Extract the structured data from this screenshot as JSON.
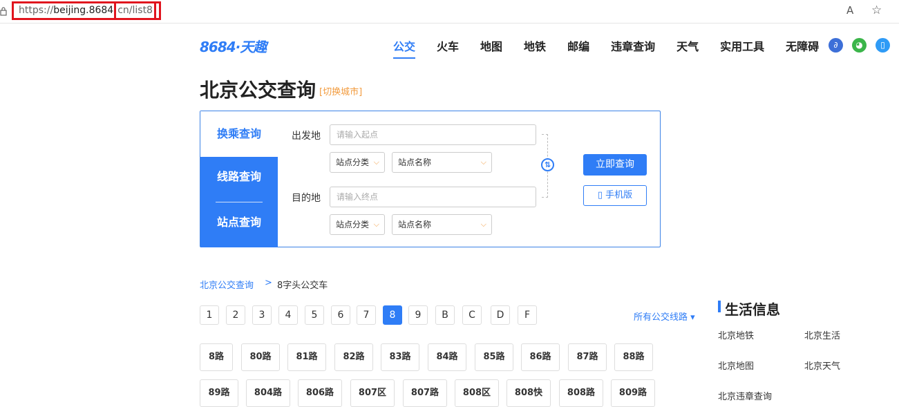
{
  "browser": {
    "url_proto": "https://",
    "url_host": "beijing.8684",
    "url_path": "cn/list8",
    "read_aloud_icon": "A",
    "favorite_icon": "☆"
  },
  "header": {
    "logo": "8684·天趣",
    "nav": [
      "公交",
      "火车",
      "地图",
      "地铁",
      "邮编",
      "违章查询",
      "天气",
      "实用工具",
      "无障碍"
    ],
    "social": [
      {
        "name": "mini-program-icon",
        "color": "#3d6fd8",
        "glyph": "∂"
      },
      {
        "name": "wechat-icon",
        "color": "#3bb54a",
        "glyph": "◕"
      },
      {
        "name": "mobile-app-icon",
        "color": "#2f9bf6",
        "glyph": "▯"
      }
    ]
  },
  "title": {
    "main": "北京公交查询",
    "switch": "[切换城市]"
  },
  "search": {
    "tabs": [
      "换乘查询",
      "线路查询",
      "站点查询"
    ],
    "from_label": "出发地",
    "from_placeholder": "请输入起点",
    "to_label": "目的地",
    "to_placeholder": "请输入终点",
    "stop_category": "站点分类",
    "stop_name": "站点名称",
    "swap_glyph": "⇅",
    "query_button": "立即查询",
    "mobile_button": "手机版"
  },
  "breadcrumb": {
    "home": "北京公交查询",
    "sep": ">",
    "current": "8字头公交车"
  },
  "letters": [
    "1",
    "2",
    "3",
    "4",
    "5",
    "6",
    "7",
    "8",
    "9",
    "B",
    "C",
    "D",
    "F"
  ],
  "active_letter": "8",
  "all_routes": "所有公交线路 ▾",
  "routes_row1": [
    "8路",
    "80路",
    "81路",
    "82路",
    "83路",
    "84路",
    "85路",
    "86路",
    "87路",
    "88路"
  ],
  "routes_row2": [
    "89路",
    "804路",
    "806路",
    "807区",
    "807路",
    "808区",
    "808快",
    "808路",
    "809路"
  ],
  "side": {
    "title": "生活信息",
    "links": [
      "北京地铁",
      "北京生活",
      "北京地图",
      "北京天气",
      "北京违章查询"
    ]
  }
}
